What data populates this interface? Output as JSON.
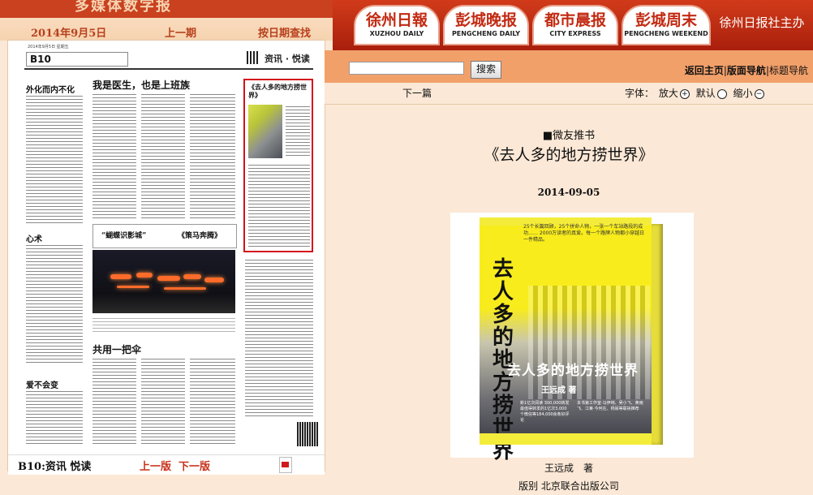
{
  "topbar": {
    "strip_title": "多媒体数字报",
    "date": "2014年9月5日",
    "prev_issue": "上一期",
    "date_search": "按日期查找"
  },
  "logos": [
    {
      "cn": "徐州日報",
      "en": "XUZHOU DAILY"
    },
    {
      "cn": "彭城晚报",
      "en": "PENGCHENG DAILY"
    },
    {
      "cn": "都市晨报",
      "en": "CITY EXPRESS"
    },
    {
      "cn": "彭城周末",
      "en": "PENGCHENG WEEKEND"
    }
  ],
  "publisher": "徐州日报社主办",
  "paper": {
    "meta": "2014年9月5日 星期五",
    "page_no": "B10",
    "section": "资讯 · 悦读",
    "headlines": {
      "h1": "外化而内不化",
      "h2": "我是医生，也是上班族",
      "h3": "心术",
      "h4": "共用一把伞",
      "h5": "爱不会变",
      "ad1": "“蝴蝶识影城”",
      "ad2": "《策马奔腾》"
    },
    "highlight_title": "《去人多的地方捞世界》"
  },
  "viewer_foot": {
    "page_label": "B10:资讯 悦读",
    "prev_page": "上一版",
    "next_page": "下一版"
  },
  "search": {
    "placeholder": "",
    "button": "搜索"
  },
  "nav": {
    "home": "返回主页",
    "sep": "|",
    "layout_nav": "版面导航",
    "sep2": "|",
    "title_nav": "标题导航"
  },
  "toolbar": {
    "next_article": "下一篇",
    "font_label": "字体：",
    "bigger": "放大",
    "default": "默认",
    "smaller": "缩小"
  },
  "article": {
    "kicker": "■微友推书",
    "title": "《去人多的地方捞世界》",
    "date": "2014-09-05",
    "author_line": "王远成　著",
    "edition_line": "版别 北京联合出版公司"
  },
  "book_cover": {
    "vertical_title": "去人多的地方捞世界",
    "blurb": "25个长篇回顾，25个拼命人物，一张一个车站路段的成功…… 2000万读者的真爱。每一个路牌人物都小穿越日一件精品。",
    "title": "去人多的地方捞世界",
    "author": "王远成 著",
    "stat": "新1亿次阅读 300,000转发最值得转发的1亿次3,000个微信等184,000余条好评论",
    "endorse": "本书第工作室·马伊琍、吴小飞、黄雨飞、江莱·今何在、杨幂等联袂推荐"
  }
}
